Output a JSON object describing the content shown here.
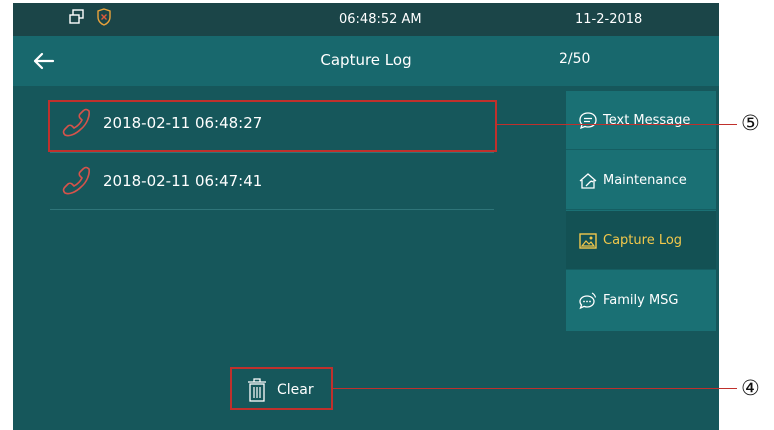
{
  "statusbar": {
    "time": "06:48:52   AM",
    "date": "11-2-2018",
    "icons": [
      "window-icon",
      "shield-icon"
    ]
  },
  "header": {
    "back_icon": "arrow-left-icon",
    "title": "Capture Log",
    "page_count": "2/50"
  },
  "logs": [
    {
      "icon": "phone-icon",
      "timestamp": "2018-02-11 06:48:27"
    },
    {
      "icon": "phone-icon",
      "timestamp": "2018-02-11 06:47:41"
    }
  ],
  "sidebar": {
    "items": [
      {
        "label": "Text Message",
        "icon": "message-icon",
        "active": false
      },
      {
        "label": "Maintenance",
        "icon": "wrench-icon",
        "active": false
      },
      {
        "label": "Capture Log",
        "icon": "image-icon",
        "active": true
      },
      {
        "label": "Family MSG",
        "icon": "chat-icon",
        "active": false
      }
    ]
  },
  "clear": {
    "label": "Clear",
    "icon": "trash-icon"
  },
  "callouts": {
    "five": "⑤",
    "four": "④"
  },
  "colors": {
    "background": "#16575b",
    "header": "#18686d",
    "accent": "#f2c84b",
    "callout": "#c0302c",
    "phone": "#d6534b"
  }
}
